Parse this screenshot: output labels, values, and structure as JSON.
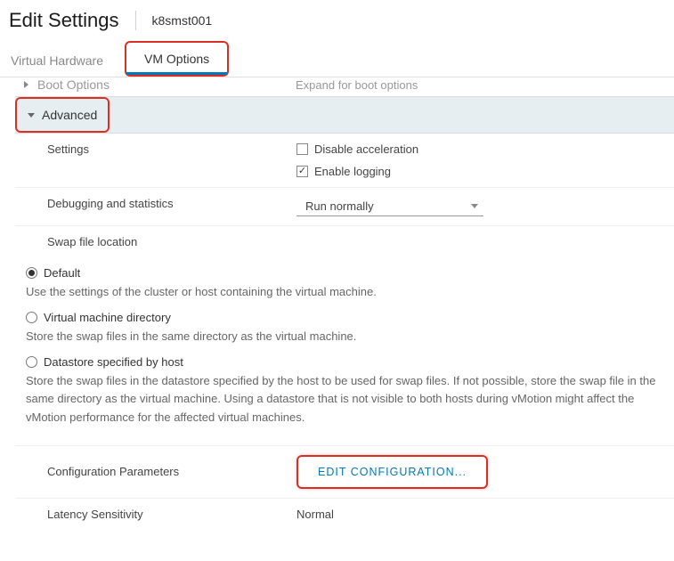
{
  "header": {
    "title": "Edit Settings",
    "subtitle": "k8smst001"
  },
  "tabs": {
    "virtual_hardware": "Virtual Hardware",
    "vm_options": "VM Options"
  },
  "sections": {
    "boot_options": {
      "label": "Boot Options",
      "summary": "Expand for boot options"
    },
    "advanced": {
      "label": "Advanced",
      "settings": {
        "label": "Settings",
        "disable_acceleration": "Disable acceleration",
        "enable_logging": "Enable logging"
      },
      "debugging": {
        "label": "Debugging and statistics",
        "value": "Run normally"
      },
      "swap": {
        "label": "Swap file location",
        "options": {
          "default": {
            "label": "Default",
            "desc": "Use the settings of the cluster or host containing the virtual machine."
          },
          "vmdir": {
            "label": "Virtual machine directory",
            "desc": "Store the swap files in the same directory as the virtual machine."
          },
          "hostds": {
            "label": "Datastore specified by host",
            "desc": "Store the swap files in the datastore specified by the host to be used for swap files. If not possible, store the swap file in the same directory as the virtual machine. Using a datastore that is not visible to both hosts during vMotion might affect the vMotion performance for the affected virtual machines."
          }
        }
      },
      "config_params": {
        "label": "Configuration Parameters",
        "button": "EDIT CONFIGURATION..."
      },
      "latency": {
        "label": "Latency Sensitivity",
        "value": "Normal"
      }
    }
  }
}
